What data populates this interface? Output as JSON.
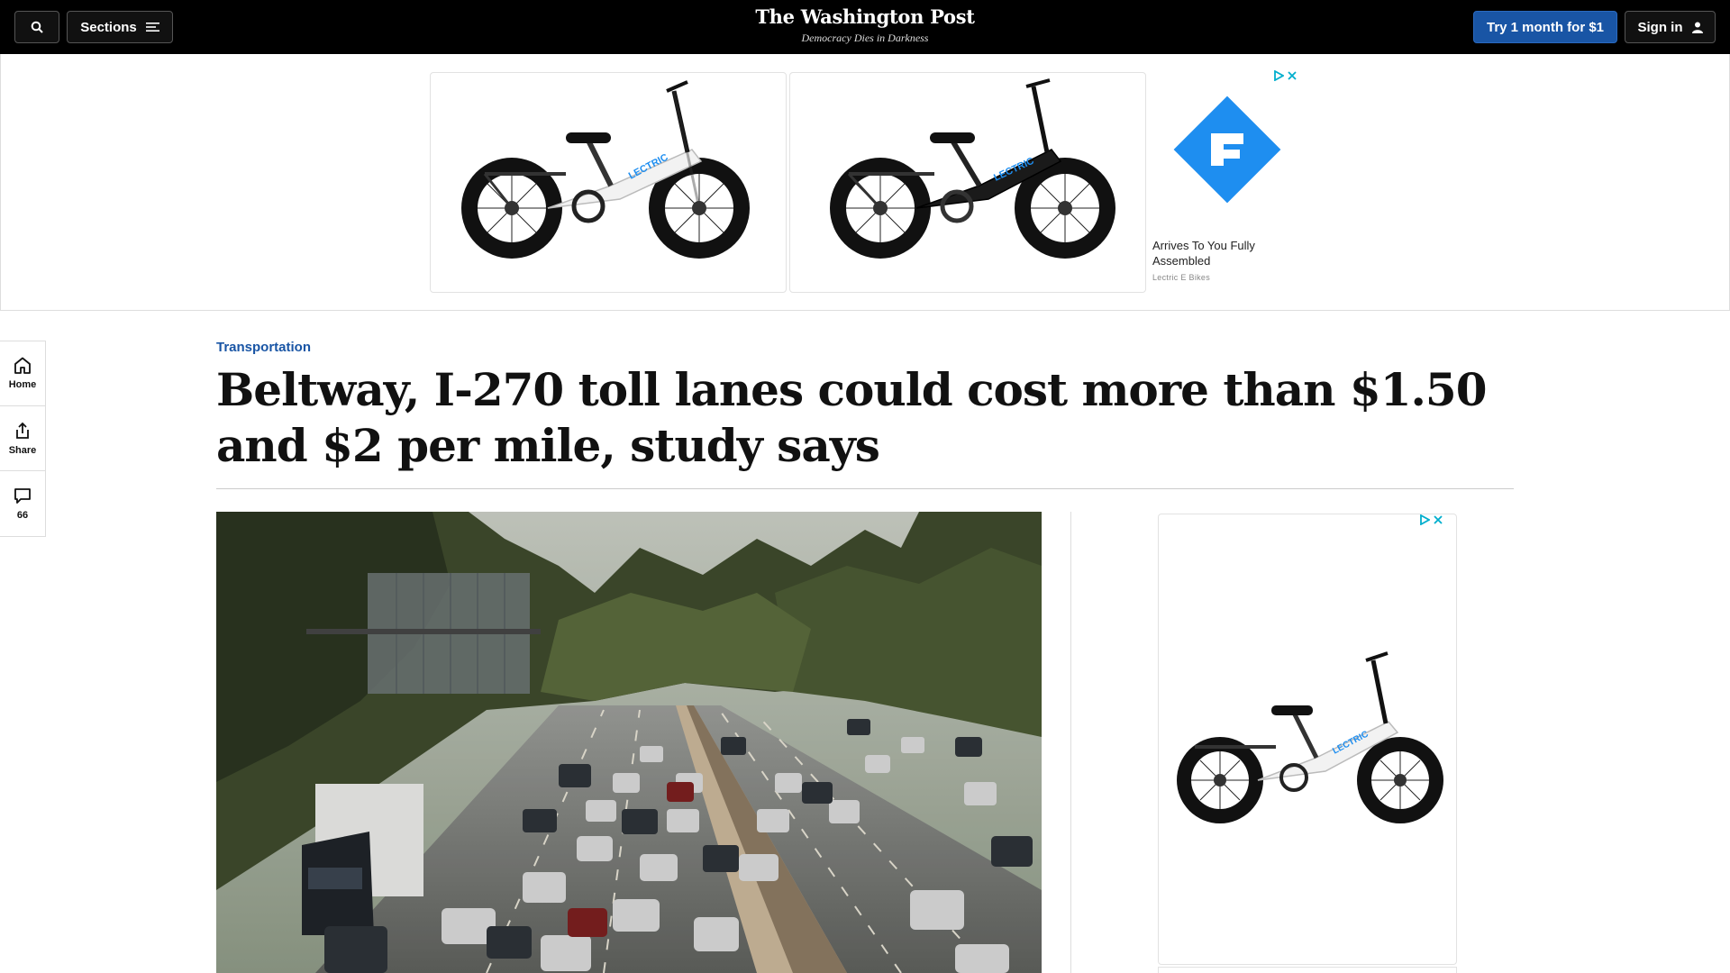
{
  "header": {
    "sections_label": "Sections",
    "logo": "The Washington Post",
    "tagline": "Democracy Dies in Darkness",
    "subscribe_label": "Try 1 month for $1",
    "signin_label": "Sign in"
  },
  "ad_top": {
    "headline": "Arrives To You Fully Assembled",
    "sponsor": "Lectric E Bikes",
    "bike_brand": "LECTRIC"
  },
  "rail": {
    "home_label": "Home",
    "share_label": "Share",
    "comments_count": "66"
  },
  "article": {
    "kicker": "Transportation",
    "headline": "Beltway, I-270 toll lanes could cost more than $1.50 and $2 per mile, study says"
  },
  "colors": {
    "nav_bg": "#000000",
    "accent_blue": "#1955a5",
    "ad_badge": "#00aecd",
    "lectric_blue": "#1e8ef0"
  }
}
